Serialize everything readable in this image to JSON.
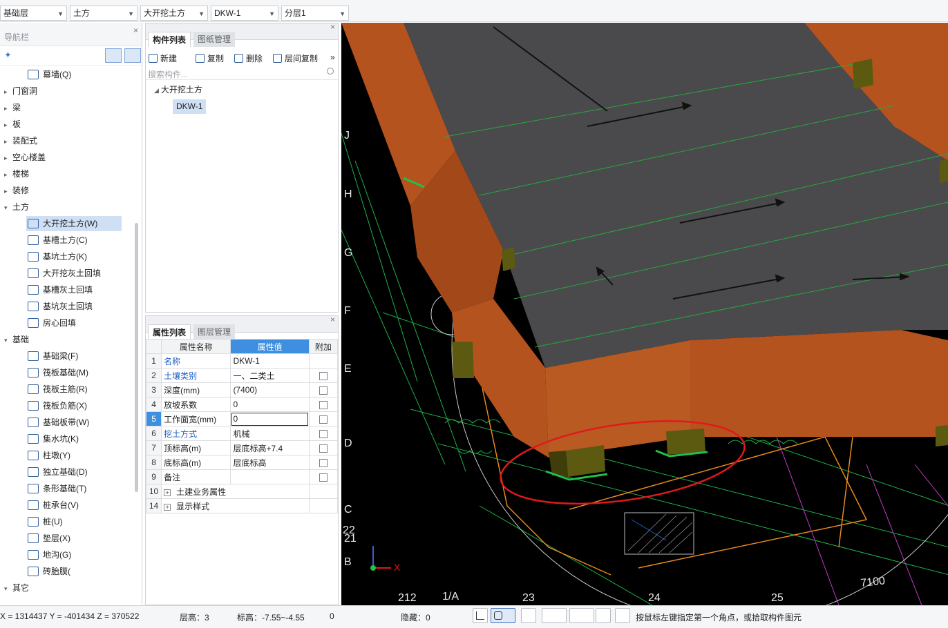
{
  "topbar": {
    "floor": "基础层",
    "category": "土方",
    "component_type": "大开挖土方",
    "component": "DKW-1",
    "layer": "分层1"
  },
  "nav": {
    "title": "导航栏",
    "close": "×",
    "items": [
      {
        "label": "幕墙(Q)",
        "level": 1,
        "icon": "curtain-wall-icon"
      },
      {
        "label": "门窗洞",
        "level": 0,
        "collapsed": true
      },
      {
        "label": "梁",
        "level": 0,
        "collapsed": true
      },
      {
        "label": "板",
        "level": 0,
        "collapsed": true
      },
      {
        "label": "装配式",
        "level": 0,
        "collapsed": true
      },
      {
        "label": "空心楼盖",
        "level": 0,
        "collapsed": true
      },
      {
        "label": "楼梯",
        "level": 0,
        "collapsed": true
      },
      {
        "label": "装修",
        "level": 0,
        "collapsed": true
      },
      {
        "label": "土方",
        "level": 0,
        "collapsed": false
      },
      {
        "label": "大开挖土方(W)",
        "level": 1,
        "icon": "excavation-icon",
        "selected": true
      },
      {
        "label": "基槽土方(C)",
        "level": 1,
        "icon": "trench-icon"
      },
      {
        "label": "基坑土方(K)",
        "level": 1,
        "icon": "pit-icon"
      },
      {
        "label": "大开挖灰土回填",
        "level": 1,
        "icon": "backfill-icon"
      },
      {
        "label": "基槽灰土回填",
        "level": 1,
        "icon": "backfill-icon"
      },
      {
        "label": "基坑灰土回填",
        "level": 1,
        "icon": "backfill-icon"
      },
      {
        "label": "房心回填",
        "level": 1,
        "icon": "room-fill-icon"
      },
      {
        "label": "基础",
        "level": 0,
        "collapsed": false
      },
      {
        "label": "基础梁(F)",
        "level": 1,
        "icon": "beam-icon"
      },
      {
        "label": "筏板基础(M)",
        "level": 1,
        "icon": "raft-icon"
      },
      {
        "label": "筏板主筋(R)",
        "level": 1,
        "icon": "rebar-icon"
      },
      {
        "label": "筏板负筋(X)",
        "level": 1,
        "icon": "rebar-icon"
      },
      {
        "label": "基础板带(W)",
        "level": 1,
        "icon": "strip-icon"
      },
      {
        "label": "集水坑(K)",
        "level": 1,
        "icon": "sump-icon"
      },
      {
        "label": "柱墩(Y)",
        "level": 1,
        "icon": "pier-icon"
      },
      {
        "label": "独立基础(D)",
        "level": 1,
        "icon": "footing-icon"
      },
      {
        "label": "条形基础(T)",
        "level": 1,
        "icon": "strip-footing-icon"
      },
      {
        "label": "桩承台(V)",
        "level": 1,
        "icon": "pile-cap-icon"
      },
      {
        "label": "桩(U)",
        "level": 1,
        "icon": "pile-icon"
      },
      {
        "label": "垫层(X)",
        "level": 1,
        "icon": "cushion-icon"
      },
      {
        "label": "地沟(G)",
        "level": 1,
        "icon": "trench-drain-icon"
      },
      {
        "label": "砖胎膜(",
        "level": 1,
        "icon": "brick-mold-icon"
      },
      {
        "label": "其它",
        "level": 0,
        "collapsed": false
      }
    ]
  },
  "comp_panel": {
    "tab_active": "构件列表",
    "tab_inactive": "图纸管理",
    "close": "×",
    "toolbar": {
      "new": "新建",
      "copy": "复制",
      "delete": "删除",
      "floor_copy": "层间复制",
      "more": "»"
    },
    "search_placeholder": "搜索构件...",
    "tree": {
      "parent": "大开挖土方",
      "child": "DKW-1"
    }
  },
  "prop_panel": {
    "tab_active": "属性列表",
    "tab_inactive": "图层管理",
    "close": "×",
    "headers": {
      "name": "属性名称",
      "value": "属性值",
      "extra": "附加"
    },
    "rows": [
      {
        "num": "1",
        "name": "名称",
        "value": "DKW-1",
        "blue": true,
        "check": false
      },
      {
        "num": "2",
        "name": "土壤类别",
        "value": "一、二类土",
        "blue": true,
        "check": true
      },
      {
        "num": "3",
        "name": "深度(mm)",
        "value": "(7400)",
        "blue": false,
        "check": true
      },
      {
        "num": "4",
        "name": "放坡系数",
        "value": "0",
        "blue": false,
        "check": true
      },
      {
        "num": "5",
        "name": "工作面宽(mm)",
        "value": "0",
        "blue": false,
        "check": true,
        "current": true
      },
      {
        "num": "6",
        "name": "挖土方式",
        "value": "机械",
        "blue": true,
        "check": true
      },
      {
        "num": "7",
        "name": "顶标高(m)",
        "value": "层底标高+7.4",
        "blue": false,
        "check": true
      },
      {
        "num": "8",
        "name": "底标高(m)",
        "value": "层底标高",
        "blue": false,
        "check": true
      },
      {
        "num": "9",
        "name": "备注",
        "value": "",
        "blue": false,
        "check": true
      },
      {
        "num": "10",
        "name": "土建业务属性",
        "value": "",
        "blue": false,
        "check": false,
        "expand": true
      },
      {
        "num": "14",
        "name": "显示样式",
        "value": "",
        "blue": false,
        "check": false,
        "expand": true
      }
    ]
  },
  "viewport": {
    "axis_labels": [
      "J",
      "H",
      "G",
      "F",
      "E",
      "D",
      "C",
      "B",
      "212",
      "1/A",
      "23",
      "24",
      "25",
      "22",
      "21"
    ],
    "dimension_text": "7100",
    "gizmo_x": "X"
  },
  "status": {
    "coords": "X = 1314437 Y = -401434 Z = 370522",
    "floor_height_label": "层高：",
    "floor_height": "3",
    "elevation_label": "标高：",
    "elevation": "-7.55~-4.55",
    "zero": "0",
    "hidden_label": "隐藏：",
    "hidden": "0",
    "hint": "按鼠标左键指定第一个角点，或拾取构件图元"
  },
  "colors": {
    "accent": "#3f8fe0",
    "selection": "#cfe0f5",
    "slab": "#4a4a4d",
    "soil": "#b5531f",
    "annotation": "#e0191c"
  }
}
